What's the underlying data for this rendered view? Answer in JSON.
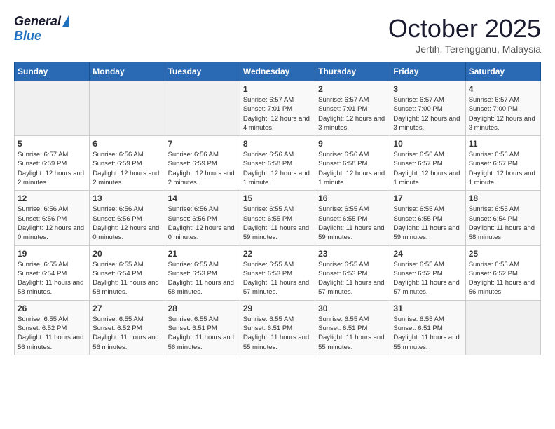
{
  "header": {
    "logo_general": "General",
    "logo_blue": "Blue",
    "month_title": "October 2025",
    "subtitle": "Jertih, Terengganu, Malaysia"
  },
  "weekdays": [
    "Sunday",
    "Monday",
    "Tuesday",
    "Wednesday",
    "Thursday",
    "Friday",
    "Saturday"
  ],
  "weeks": [
    [
      {
        "day": "",
        "sunrise": "",
        "sunset": "",
        "daylight": ""
      },
      {
        "day": "",
        "sunrise": "",
        "sunset": "",
        "daylight": ""
      },
      {
        "day": "",
        "sunrise": "",
        "sunset": "",
        "daylight": ""
      },
      {
        "day": "1",
        "sunrise": "Sunrise: 6:57 AM",
        "sunset": "Sunset: 7:01 PM",
        "daylight": "Daylight: 12 hours and 4 minutes."
      },
      {
        "day": "2",
        "sunrise": "Sunrise: 6:57 AM",
        "sunset": "Sunset: 7:01 PM",
        "daylight": "Daylight: 12 hours and 3 minutes."
      },
      {
        "day": "3",
        "sunrise": "Sunrise: 6:57 AM",
        "sunset": "Sunset: 7:00 PM",
        "daylight": "Daylight: 12 hours and 3 minutes."
      },
      {
        "day": "4",
        "sunrise": "Sunrise: 6:57 AM",
        "sunset": "Sunset: 7:00 PM",
        "daylight": "Daylight: 12 hours and 3 minutes."
      }
    ],
    [
      {
        "day": "5",
        "sunrise": "Sunrise: 6:57 AM",
        "sunset": "Sunset: 6:59 PM",
        "daylight": "Daylight: 12 hours and 2 minutes."
      },
      {
        "day": "6",
        "sunrise": "Sunrise: 6:56 AM",
        "sunset": "Sunset: 6:59 PM",
        "daylight": "Daylight: 12 hours and 2 minutes."
      },
      {
        "day": "7",
        "sunrise": "Sunrise: 6:56 AM",
        "sunset": "Sunset: 6:59 PM",
        "daylight": "Daylight: 12 hours and 2 minutes."
      },
      {
        "day": "8",
        "sunrise": "Sunrise: 6:56 AM",
        "sunset": "Sunset: 6:58 PM",
        "daylight": "Daylight: 12 hours and 1 minute."
      },
      {
        "day": "9",
        "sunrise": "Sunrise: 6:56 AM",
        "sunset": "Sunset: 6:58 PM",
        "daylight": "Daylight: 12 hours and 1 minute."
      },
      {
        "day": "10",
        "sunrise": "Sunrise: 6:56 AM",
        "sunset": "Sunset: 6:57 PM",
        "daylight": "Daylight: 12 hours and 1 minute."
      },
      {
        "day": "11",
        "sunrise": "Sunrise: 6:56 AM",
        "sunset": "Sunset: 6:57 PM",
        "daylight": "Daylight: 12 hours and 1 minute."
      }
    ],
    [
      {
        "day": "12",
        "sunrise": "Sunrise: 6:56 AM",
        "sunset": "Sunset: 6:56 PM",
        "daylight": "Daylight: 12 hours and 0 minutes."
      },
      {
        "day": "13",
        "sunrise": "Sunrise: 6:56 AM",
        "sunset": "Sunset: 6:56 PM",
        "daylight": "Daylight: 12 hours and 0 minutes."
      },
      {
        "day": "14",
        "sunrise": "Sunrise: 6:56 AM",
        "sunset": "Sunset: 6:56 PM",
        "daylight": "Daylight: 12 hours and 0 minutes."
      },
      {
        "day": "15",
        "sunrise": "Sunrise: 6:55 AM",
        "sunset": "Sunset: 6:55 PM",
        "daylight": "Daylight: 11 hours and 59 minutes."
      },
      {
        "day": "16",
        "sunrise": "Sunrise: 6:55 AM",
        "sunset": "Sunset: 6:55 PM",
        "daylight": "Daylight: 11 hours and 59 minutes."
      },
      {
        "day": "17",
        "sunrise": "Sunrise: 6:55 AM",
        "sunset": "Sunset: 6:55 PM",
        "daylight": "Daylight: 11 hours and 59 minutes."
      },
      {
        "day": "18",
        "sunrise": "Sunrise: 6:55 AM",
        "sunset": "Sunset: 6:54 PM",
        "daylight": "Daylight: 11 hours and 58 minutes."
      }
    ],
    [
      {
        "day": "19",
        "sunrise": "Sunrise: 6:55 AM",
        "sunset": "Sunset: 6:54 PM",
        "daylight": "Daylight: 11 hours and 58 minutes."
      },
      {
        "day": "20",
        "sunrise": "Sunrise: 6:55 AM",
        "sunset": "Sunset: 6:54 PM",
        "daylight": "Daylight: 11 hours and 58 minutes."
      },
      {
        "day": "21",
        "sunrise": "Sunrise: 6:55 AM",
        "sunset": "Sunset: 6:53 PM",
        "daylight": "Daylight: 11 hours and 58 minutes."
      },
      {
        "day": "22",
        "sunrise": "Sunrise: 6:55 AM",
        "sunset": "Sunset: 6:53 PM",
        "daylight": "Daylight: 11 hours and 57 minutes."
      },
      {
        "day": "23",
        "sunrise": "Sunrise: 6:55 AM",
        "sunset": "Sunset: 6:53 PM",
        "daylight": "Daylight: 11 hours and 57 minutes."
      },
      {
        "day": "24",
        "sunrise": "Sunrise: 6:55 AM",
        "sunset": "Sunset: 6:52 PM",
        "daylight": "Daylight: 11 hours and 57 minutes."
      },
      {
        "day": "25",
        "sunrise": "Sunrise: 6:55 AM",
        "sunset": "Sunset: 6:52 PM",
        "daylight": "Daylight: 11 hours and 56 minutes."
      }
    ],
    [
      {
        "day": "26",
        "sunrise": "Sunrise: 6:55 AM",
        "sunset": "Sunset: 6:52 PM",
        "daylight": "Daylight: 11 hours and 56 minutes."
      },
      {
        "day": "27",
        "sunrise": "Sunrise: 6:55 AM",
        "sunset": "Sunset: 6:52 PM",
        "daylight": "Daylight: 11 hours and 56 minutes."
      },
      {
        "day": "28",
        "sunrise": "Sunrise: 6:55 AM",
        "sunset": "Sunset: 6:51 PM",
        "daylight": "Daylight: 11 hours and 56 minutes."
      },
      {
        "day": "29",
        "sunrise": "Sunrise: 6:55 AM",
        "sunset": "Sunset: 6:51 PM",
        "daylight": "Daylight: 11 hours and 55 minutes."
      },
      {
        "day": "30",
        "sunrise": "Sunrise: 6:55 AM",
        "sunset": "Sunset: 6:51 PM",
        "daylight": "Daylight: 11 hours and 55 minutes."
      },
      {
        "day": "31",
        "sunrise": "Sunrise: 6:55 AM",
        "sunset": "Sunset: 6:51 PM",
        "daylight": "Daylight: 11 hours and 55 minutes."
      },
      {
        "day": "",
        "sunrise": "",
        "sunset": "",
        "daylight": ""
      }
    ]
  ]
}
